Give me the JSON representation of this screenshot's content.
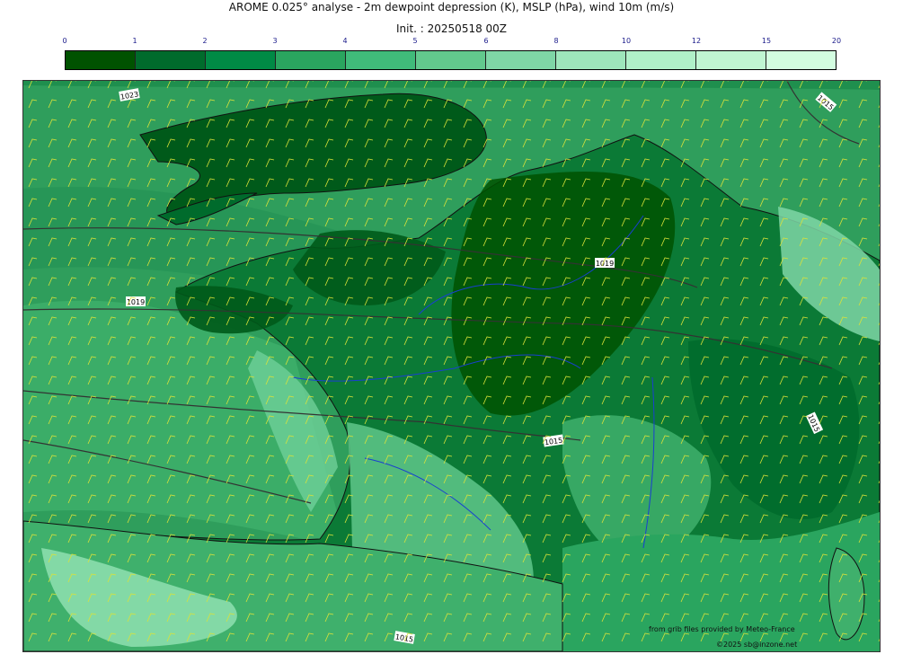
{
  "title": "AROME 0.025° analyse - 2m dewpoint depression (K), MSLP (hPa), wind 10m (m/s)",
  "subtitle": "Init. : 20250518 00Z",
  "colorbar": {
    "ticks": [
      "0",
      "1",
      "2",
      "3",
      "4",
      "5",
      "6",
      "8",
      "10",
      "12",
      "15",
      "20"
    ],
    "colors": [
      "#005200",
      "#006b2c",
      "#008a45",
      "#2aa55f",
      "#40bb7a",
      "#62c98d",
      "#7fd6a6",
      "#9ee6bb",
      "#b0f0c8",
      "#c0f5d2",
      "#d3fde0"
    ]
  },
  "isobars": [
    {
      "label": "1023"
    },
    {
      "label": "1019"
    },
    {
      "label": "1019"
    },
    {
      "label": "1015"
    },
    {
      "label": "1015"
    },
    {
      "label": "1015"
    },
    {
      "label": "1015"
    }
  ],
  "credits": {
    "source": "from grib files provided by Meteo-France",
    "copyright": "©2025 sb@inzone.net"
  }
}
